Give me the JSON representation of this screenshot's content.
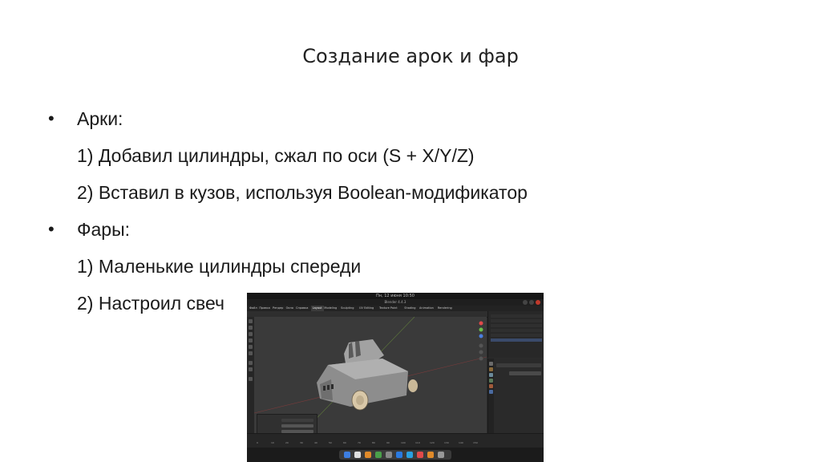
{
  "slide": {
    "title": "Создание арок и фар",
    "bullets": [
      {
        "label": "Арки:",
        "items": [
          "1) Добавил цилиндры, сжал по оси (S + X/Y/Z)",
          "2) Вставил в кузов, используя Boolean-модификатор"
        ]
      },
      {
        "label": "Фары:",
        "items": [
          "1) Маленькие цилиндры спереди",
          "2) Настроил свеч"
        ]
      }
    ],
    "bullet_glyph": "•"
  },
  "screenshot": {
    "os_bar_text": "Пн, 12 июня 10:50",
    "window_title": "Blender 4.4.3",
    "menu_items": [
      "Файл",
      "Правка",
      "Рендер",
      "Окно",
      "Справка",
      "Layout",
      "Modeling",
      "Sculpting",
      "UV Editing",
      "Texture Paint",
      "Shading",
      "Animation",
      "Rendering"
    ],
    "active_menu": "Layout",
    "timeline_ticks": [
      "0",
      "10",
      "20",
      "30",
      "40",
      "50",
      "60",
      "70",
      "80",
      "90",
      "100",
      "110",
      "120",
      "130",
      "140",
      "150"
    ],
    "colors": {
      "viewport": "#3a3a3a",
      "car_body": "#9a9a9a",
      "wheel": "#d9c8a8",
      "gizmo_x": "#e04a4a",
      "gizmo_y": "#6cc04a",
      "gizmo_z": "#4a7fe0",
      "selection": "#3a4a6b"
    },
    "dock_icons": [
      "finder-icon",
      "files-icon",
      "browser-icon",
      "chrome-icon",
      "settings-icon",
      "vscode-icon",
      "telegram-icon",
      "mail-icon",
      "blender-icon",
      "trash-icon"
    ]
  }
}
